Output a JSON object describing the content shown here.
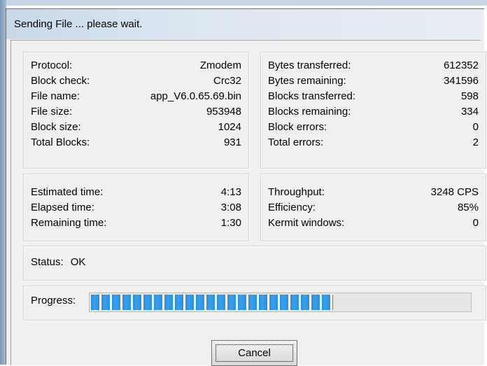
{
  "window": {
    "title": "Sending File ... please wait."
  },
  "file_info": [
    {
      "label": "Protocol:",
      "value": "Zmodem"
    },
    {
      "label": "Block check:",
      "value": "Crc32"
    },
    {
      "label": "File name:",
      "value": "app_V6.0.65.69.bin"
    },
    {
      "label": "File size:",
      "value": "953948"
    },
    {
      "label": "Block size:",
      "value": "1024"
    },
    {
      "label": "Total Blocks:",
      "value": "931"
    }
  ],
  "transfer_stats": [
    {
      "label": "Bytes transferred:",
      "value": "612352"
    },
    {
      "label": "Bytes remaining:",
      "value": "341596"
    },
    {
      "label": "Blocks transferred:",
      "value": "598"
    },
    {
      "label": "Blocks remaining:",
      "value": "334"
    },
    {
      "label": "Block errors:",
      "value": "0"
    },
    {
      "label": "Total errors:",
      "value": "2"
    }
  ],
  "timing": [
    {
      "label": "Estimated time:",
      "value": "4:13"
    },
    {
      "label": "Elapsed time:",
      "value": "3:08"
    },
    {
      "label": "Remaining time:",
      "value": "1:30"
    }
  ],
  "performance": [
    {
      "label": "Throughput:",
      "value": "3248 CPS"
    },
    {
      "label": "Efficiency:",
      "value": "85%"
    },
    {
      "label": "Kermit windows:",
      "value": "0"
    }
  ],
  "status": {
    "label": "Status:",
    "value": "OK"
  },
  "progress": {
    "label": "Progress:",
    "fraction": 0.64
  },
  "buttons": {
    "cancel": "Cancel"
  },
  "colors": {
    "progress_fill": "#2a8ee0",
    "titlebar": "#c9d8e9"
  }
}
